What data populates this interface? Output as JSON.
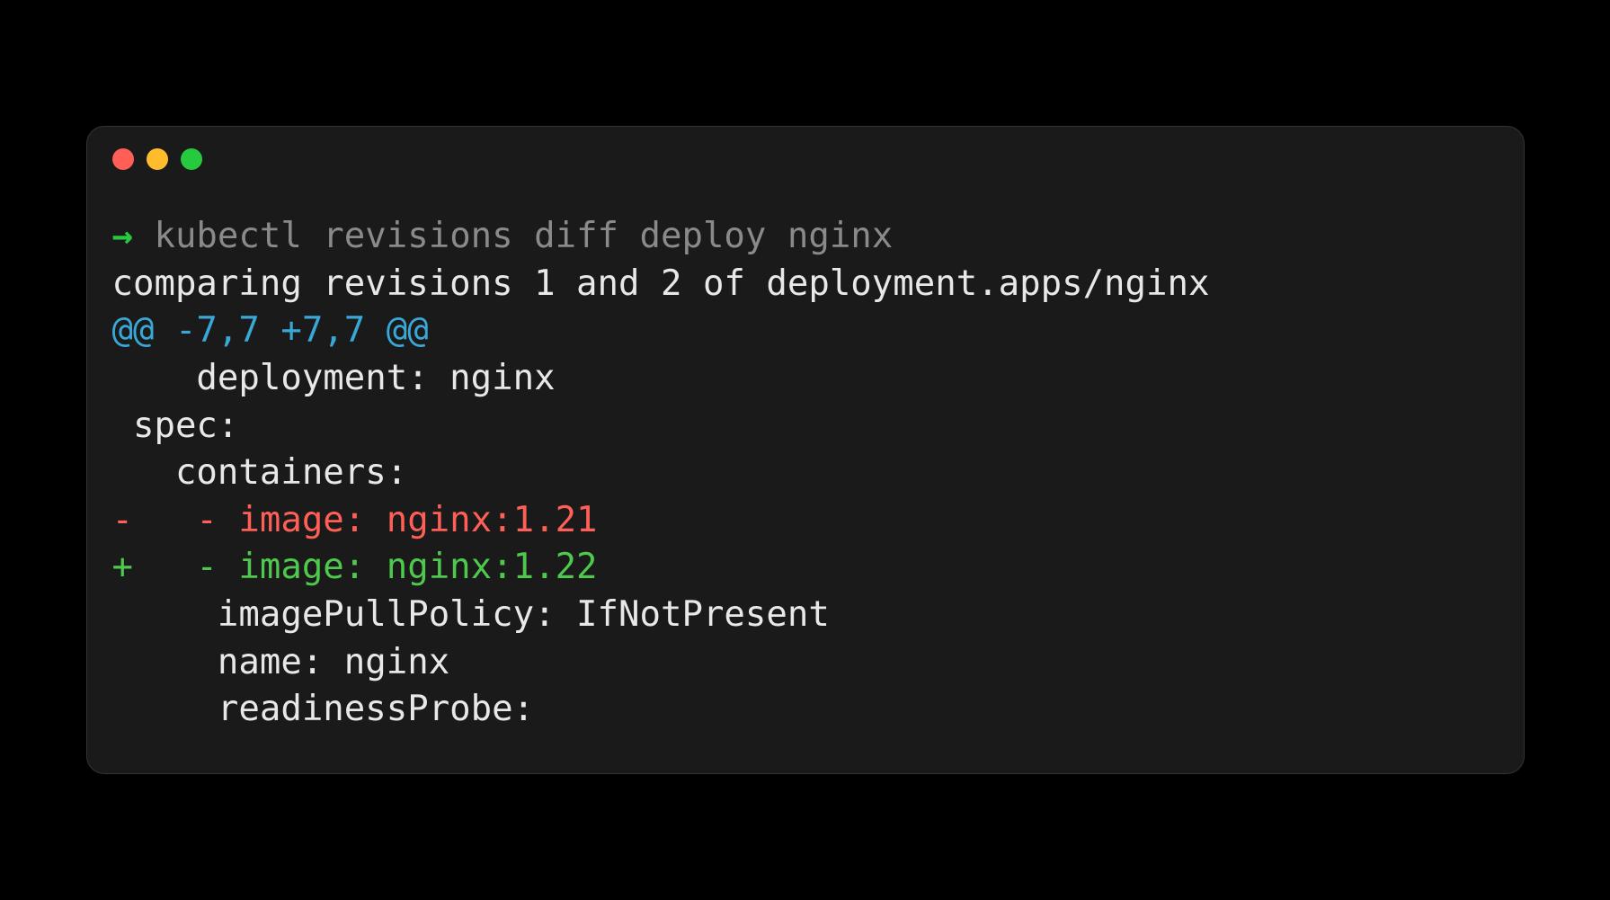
{
  "prompt": {
    "arrow": "→",
    "command": "kubectl revisions diff deploy nginx"
  },
  "output": {
    "comparing": "comparing revisions 1 and 2 of deployment.apps/nginx",
    "hunk": "@@ -7,7 +7,7 @@",
    "context1": "    deployment: nginx",
    "context2": " spec:",
    "context3": "   containers:",
    "removed": "-   - image: nginx:1.21",
    "added": "+   - image: nginx:1.22",
    "context4": "     imagePullPolicy: IfNotPresent",
    "context5": "     name: nginx",
    "context6": "     readinessProbe:"
  }
}
